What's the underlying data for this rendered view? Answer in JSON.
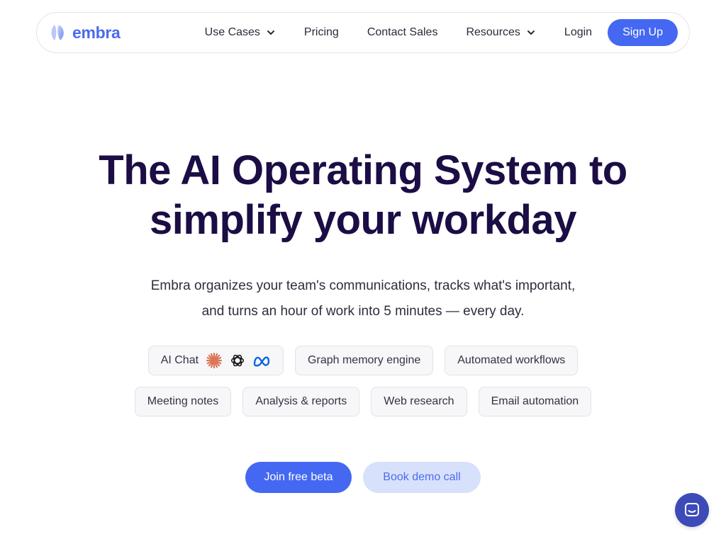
{
  "brand": {
    "name": "embra",
    "color": "#4a6cf0"
  },
  "nav": {
    "items": [
      {
        "label": "Use Cases",
        "dropdown": true
      },
      {
        "label": "Pricing",
        "dropdown": false
      },
      {
        "label": "Contact Sales",
        "dropdown": false
      },
      {
        "label": "Resources",
        "dropdown": true
      },
      {
        "label": "Login",
        "dropdown": false
      }
    ],
    "signup_label": "Sign Up"
  },
  "hero": {
    "title_line1": "The AI Operating System to",
    "title_line2": "simplify your workday",
    "subtitle_line1": "Embra organizes your team's communications, tracks what's important,",
    "subtitle_line2": "and turns an hour of work into 5 minutes — every day."
  },
  "features": {
    "row1": [
      {
        "label": "AI Chat",
        "icons": [
          "claude-icon",
          "openai-icon",
          "meta-icon"
        ]
      },
      {
        "label": "Graph memory engine"
      },
      {
        "label": "Automated workflows"
      }
    ],
    "row2": [
      {
        "label": "Meeting notes"
      },
      {
        "label": "Analysis & reports"
      },
      {
        "label": "Web research"
      },
      {
        "label": "Email automation"
      }
    ]
  },
  "cta": {
    "primary_label": "Join free beta",
    "secondary_label": "Book demo call"
  },
  "colors": {
    "accent": "#4468f2",
    "title": "#1c0d45",
    "secondary_button_bg": "#d8e1fb",
    "chat_bubble": "#3d4bb8"
  },
  "chat_widget": {
    "icon": "chat-icon"
  }
}
